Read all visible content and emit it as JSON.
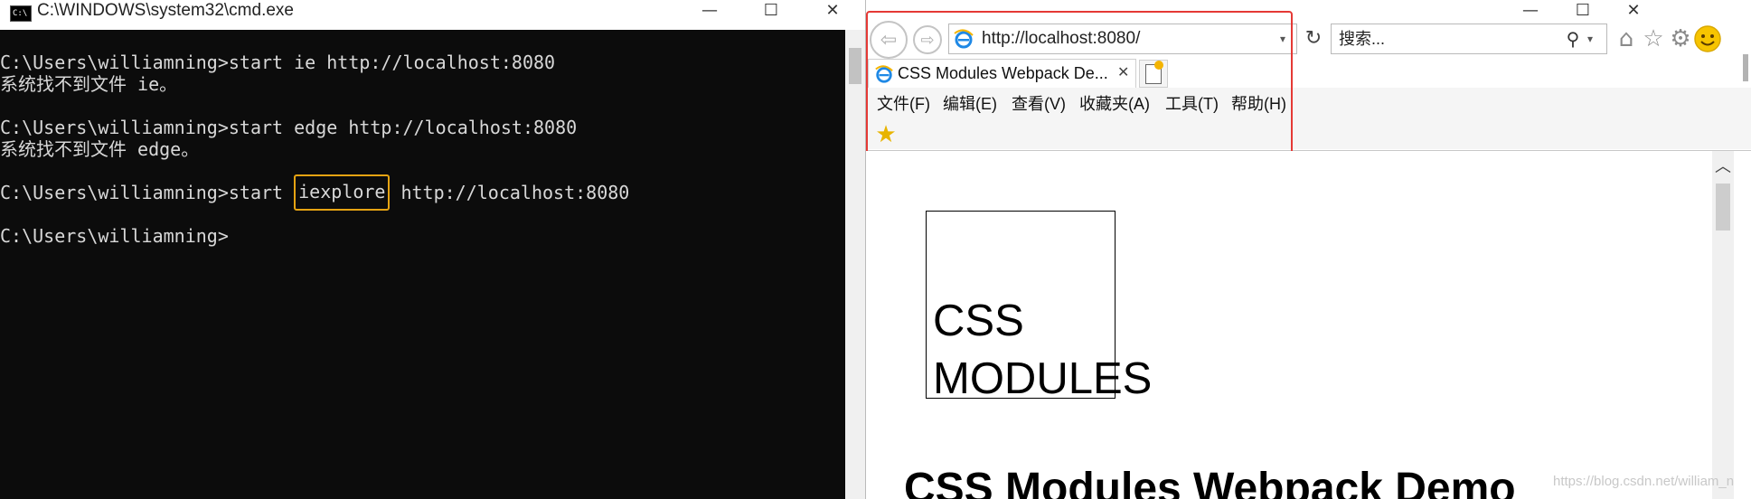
{
  "cmd": {
    "title": "C:\\WINDOWS\\system32\\cmd.exe",
    "icon_label": "C:\\",
    "window_controls": {
      "minimize": "—",
      "maximize": "☐",
      "close": "✕"
    },
    "lines": [
      "C:\\Users\\williamning>start ie http://localhost:8080",
      "系统找不到文件 ie。",
      "C:\\Users\\williamning>start edge http://localhost:8080",
      "系统找不到文件 edge。"
    ],
    "highlight_line": {
      "prefix": "C:\\Users\\williamning>start ",
      "highlighted": "iexplore",
      "suffix": " http://localhost:8080"
    },
    "prompt": "C:\\Users\\williamning>"
  },
  "ie": {
    "window_controls": {
      "minimize": "—",
      "maximize": "☐",
      "close": "✕"
    },
    "back_icon": "⇦",
    "forward_icon": "⇨",
    "address": {
      "url": "http://localhost:8080/",
      "dropdown": "▾"
    },
    "refresh_icon": "↻",
    "search": {
      "placeholder": "搜索...",
      "icon": "⚲",
      "dropdown": "▾"
    },
    "toolbar_icons": {
      "home": "⌂",
      "favorites": "☆",
      "settings": "⚙",
      "feedback": "☺"
    },
    "tab": {
      "label": "CSS Modules Webpack De...",
      "close": "✕"
    },
    "menu": [
      "文件(F)",
      "编辑(E)",
      "查看(V)",
      "收藏夹(A)",
      "工具(T)",
      "帮助(H)"
    ],
    "fav_add_icon": "★",
    "scroll_up": "︿",
    "page": {
      "box_lines": [
        "CSS",
        "MODULES"
      ],
      "heading": "CSS Modules Webpack Demo"
    }
  },
  "watermark": "https://blog.csdn.net/william_n",
  "colors": {
    "cmd_bg": "#0c0c0c",
    "cmd_text": "#d8d8d8",
    "cmd_highlight_border": "#e5a312",
    "ie_highlight_border": "#e53935",
    "ie_logo": "#1e88e5"
  }
}
